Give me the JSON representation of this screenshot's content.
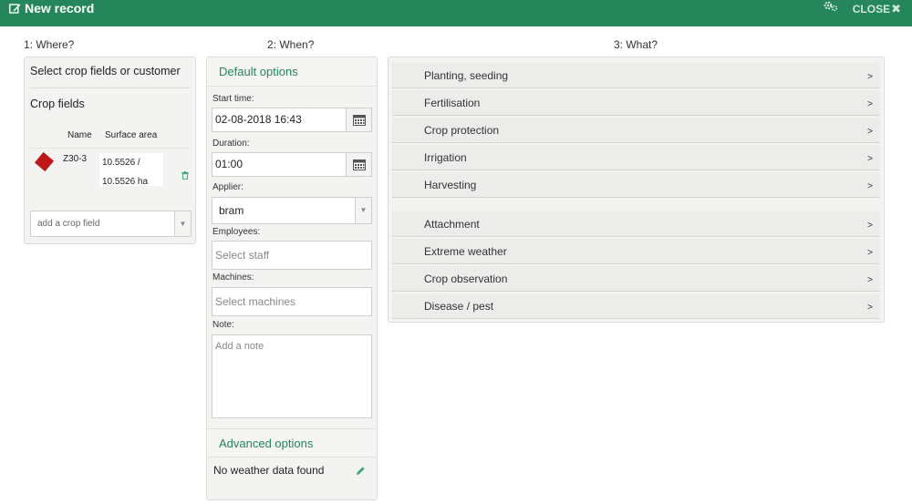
{
  "header": {
    "title": "New record",
    "close_label": "CLOSE"
  },
  "columns": {
    "where": "1: Where?",
    "when": "2: When?",
    "what": "3: What?"
  },
  "where": {
    "heading": "Select crop fields or customer",
    "subheading": "Crop fields",
    "table_headers": {
      "name": "Name",
      "surface_area": "Surface area"
    },
    "row": {
      "name": "Z30-3",
      "area_line1": "10.5526 /",
      "area_line2": "10.5526 ha"
    },
    "add_field_placeholder": "add a crop field"
  },
  "when": {
    "default_options": "Default options",
    "start_time_label": "Start time:",
    "start_time_value": "02-08-2018 16:43",
    "duration_label": "Duration:",
    "duration_value": "01:00",
    "applier_label": "Applier:",
    "applier_value": "bram",
    "employees_label": "Employees:",
    "employees_placeholder": "Select staff",
    "machines_label": "Machines:",
    "machines_placeholder": "Select machines",
    "note_label": "Note:",
    "note_placeholder": "Add a note",
    "advanced_options": "Advanced options",
    "weather_text": "No weather data found"
  },
  "what": {
    "group1": [
      "Planting, seeding",
      "Fertilisation",
      "Crop protection",
      "Irrigation",
      "Harvesting"
    ],
    "group2": [
      "Attachment",
      "Extreme weather",
      "Crop observation",
      "Disease / pest"
    ],
    "arrow": ">"
  },
  "colors": {
    "brand": "#24865a",
    "field": "#c01818"
  }
}
